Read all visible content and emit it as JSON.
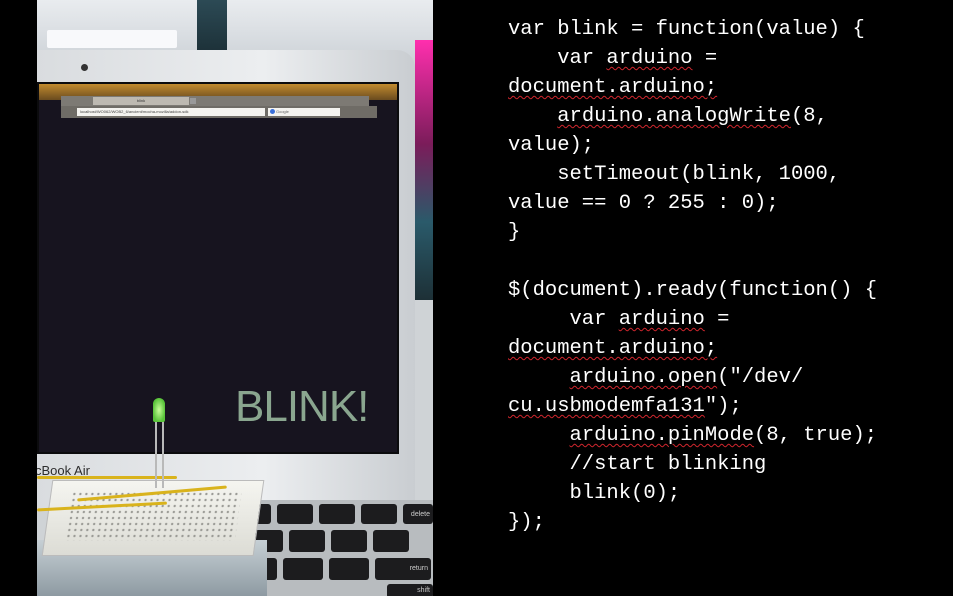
{
  "photo": {
    "browser": {
      "tab_label": "blink",
      "url": "localhost/WO062/WOB2_6/ancient/mocha-mozilla/addon-sdk",
      "search_placeholder": "Google"
    },
    "screen_text": "BLINK!",
    "laptop_brand": "cBook Air",
    "keyboard_keys": [
      "delete",
      "return",
      "shift"
    ]
  },
  "code": {
    "lines": [
      [
        {
          "t": "var blink = function(value) {"
        }
      ],
      [
        {
          "t": "    var "
        },
        {
          "t": "arduino",
          "err": true
        },
        {
          "t": " ="
        }
      ],
      [
        {
          "t": "document.arduino;",
          "err": true
        }
      ],
      [
        {
          "t": "    "
        },
        {
          "t": "arduino.analogWrite",
          "err": true
        },
        {
          "t": "(8,"
        }
      ],
      [
        {
          "t": "value);"
        }
      ],
      [
        {
          "t": "    setTimeout(blink, 1000,"
        }
      ],
      [
        {
          "t": "value == 0 ? 255 : 0);"
        }
      ],
      [
        {
          "t": "}"
        }
      ],
      [
        {
          "t": ""
        }
      ],
      [
        {
          "t": "$(document).ready(function() {"
        }
      ],
      [
        {
          "t": "     var "
        },
        {
          "t": "arduino",
          "err": true
        },
        {
          "t": " ="
        }
      ],
      [
        {
          "t": "document.arduino;",
          "err": true
        }
      ],
      [
        {
          "t": "     "
        },
        {
          "t": "arduino.open",
          "err": true
        },
        {
          "t": "(\"/dev/"
        }
      ],
      [
        {
          "t": "cu.usbmodemfa131",
          "err": true
        },
        {
          "t": "\");"
        }
      ],
      [
        {
          "t": "     "
        },
        {
          "t": "arduino.pinMode",
          "err": true
        },
        {
          "t": "(8, true);"
        }
      ],
      [
        {
          "t": "     //start blinking"
        }
      ],
      [
        {
          "t": "     blink(0);"
        }
      ],
      [
        {
          "t": "});"
        }
      ]
    ]
  }
}
